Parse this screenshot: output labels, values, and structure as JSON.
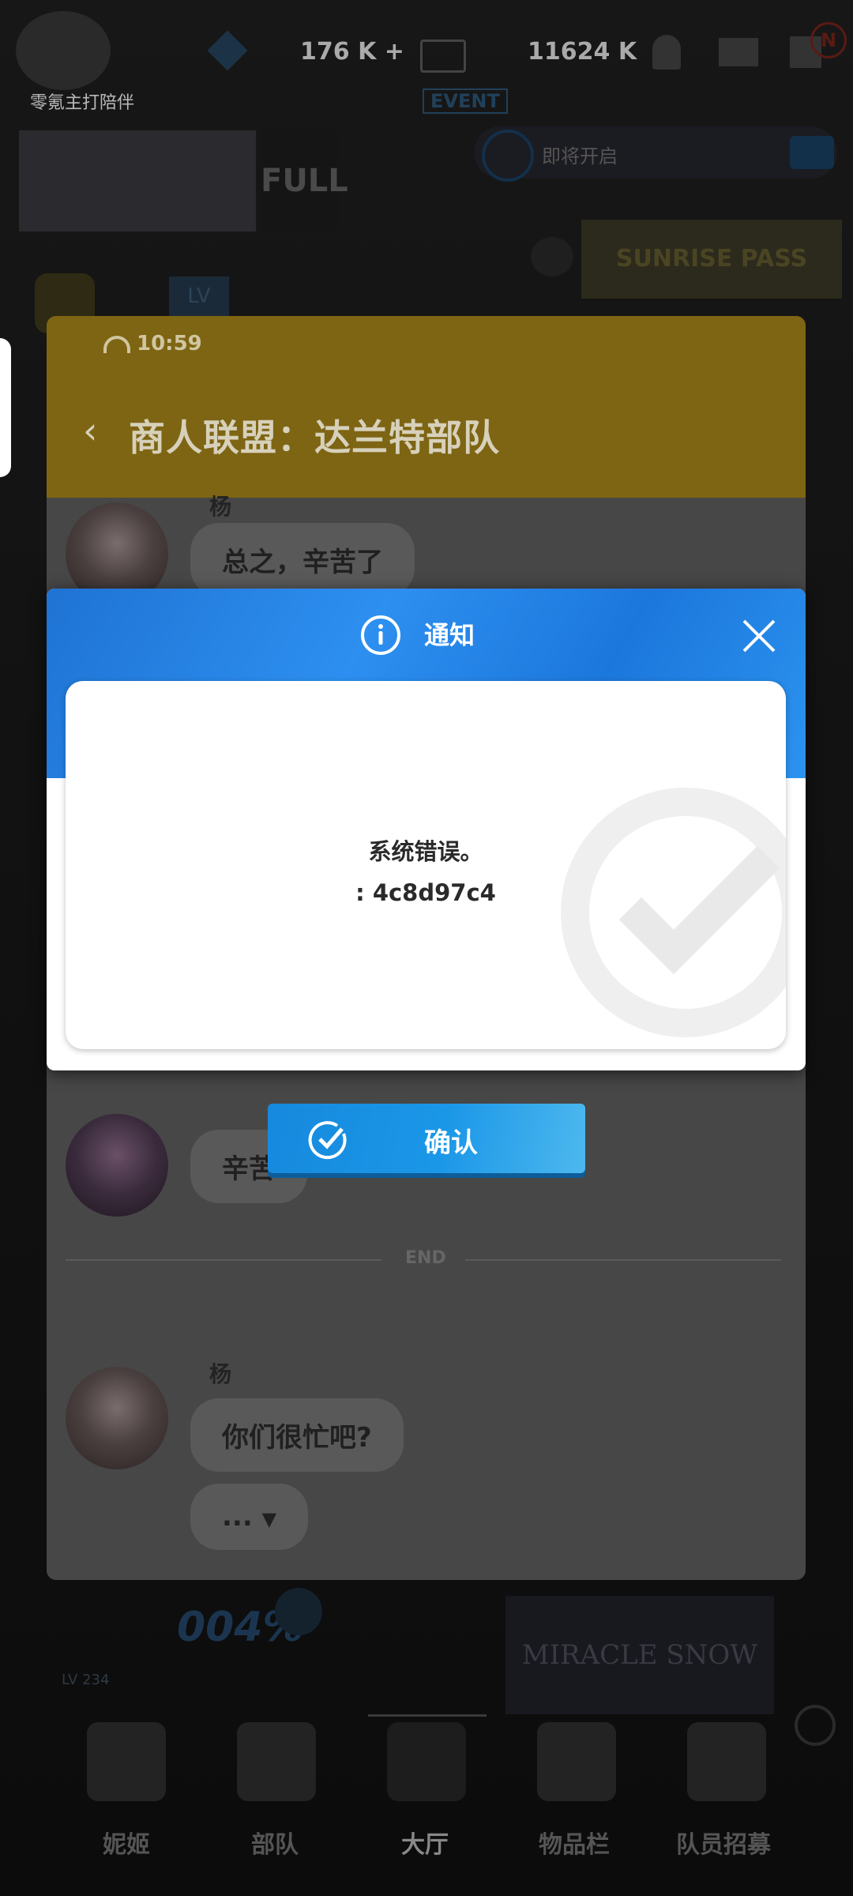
{
  "status": {
    "time": "10:59"
  },
  "topbar": {
    "profile_label": "零氪主打陪伴",
    "level": "LV",
    "stat1": "176 K",
    "stat2": "11624 K",
    "event": "EVENT",
    "event_notice": "即将开启",
    "banner_full": "FULL",
    "sunrise": "SUNRISE PASS"
  },
  "chat": {
    "title": "商人联盟：达兰特部队",
    "messages": [
      {
        "speaker": "杨",
        "text": "总之，辛苦了"
      },
      {
        "speaker": "",
        "text": "辛苦"
      },
      {
        "speaker": "杨",
        "text": "你们很忙吧?"
      },
      {
        "speaker": "",
        "text": "..."
      }
    ],
    "end_label": "END"
  },
  "dialog": {
    "title": "通知",
    "message_line1": "系统错误。",
    "message_line2": ": 4c8d97c4",
    "confirm_label": "确认"
  },
  "bottom_nav": {
    "items": [
      "妮姬",
      "部队",
      "大厅",
      "物品栏",
      "队员招募"
    ]
  },
  "lobby": {
    "progress_label": "004%",
    "lv": "LV 234",
    "miracle_snow": "MIRACLE SNOW"
  }
}
